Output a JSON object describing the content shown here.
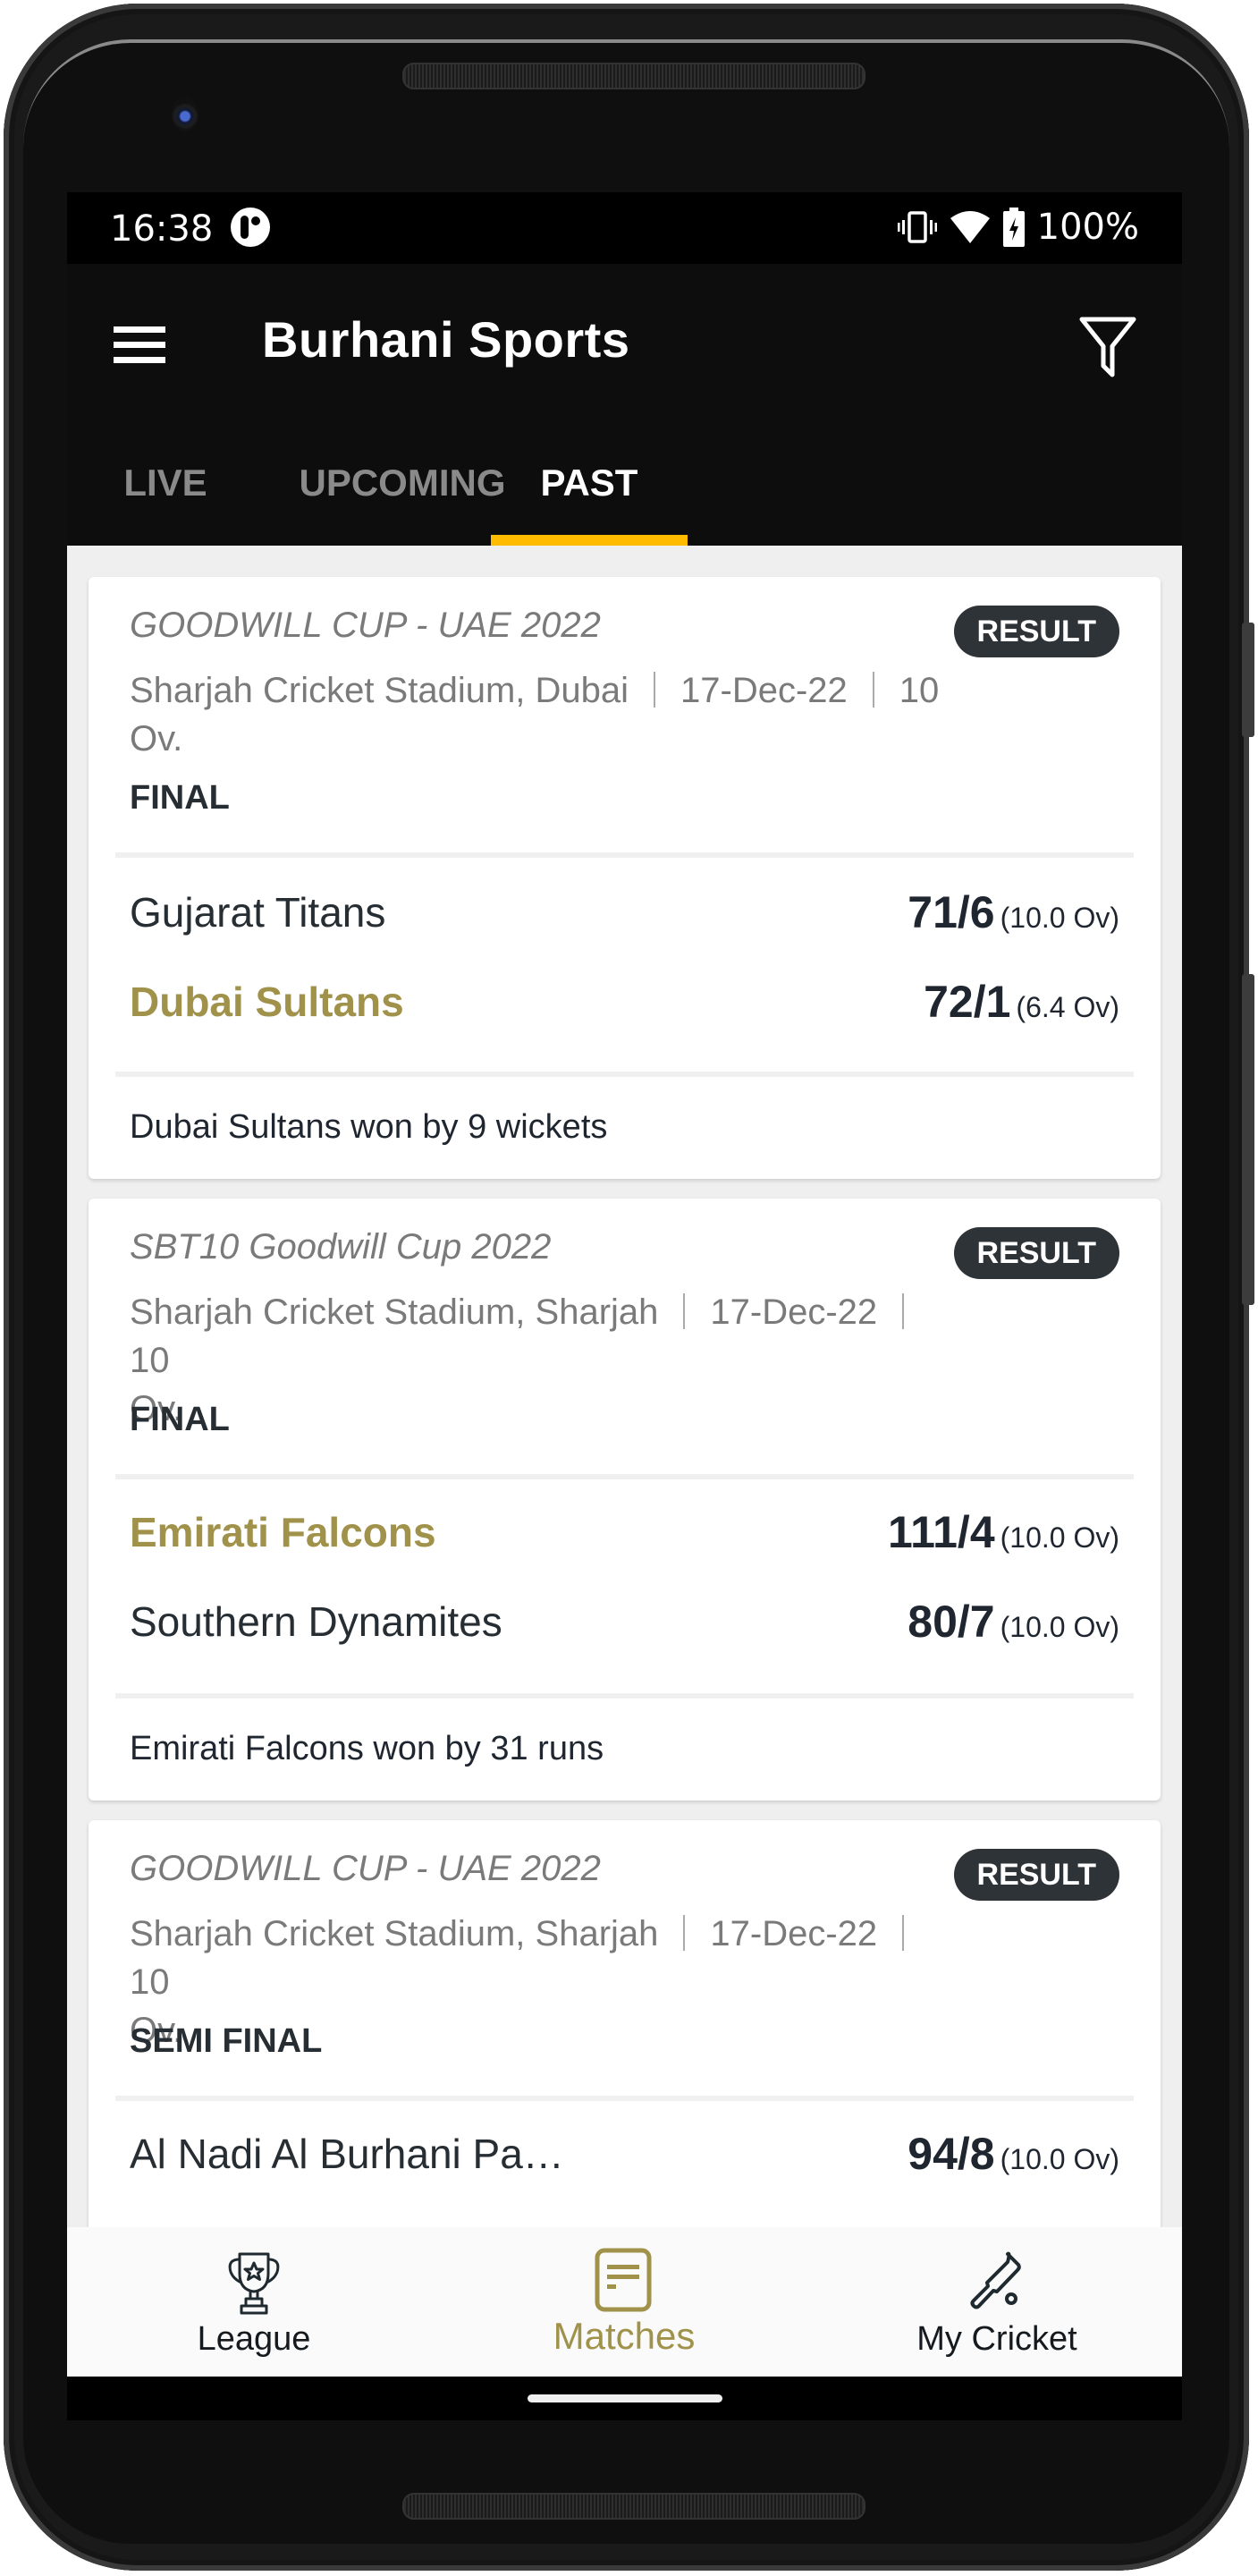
{
  "status_bar": {
    "time": "16:38",
    "battery_percent": "100%",
    "icons": [
      "notification-app-icon",
      "vibrate-icon",
      "wifi-icon",
      "battery-charging-icon"
    ]
  },
  "app_bar": {
    "title": "Burhani Sports",
    "menu_icon": "hamburger-menu-icon",
    "filter_icon": "filter-icon"
  },
  "tabs": [
    {
      "label": "LIVE",
      "active": false
    },
    {
      "label": "UPCOMING",
      "active": false
    },
    {
      "label": "PAST",
      "active": true
    }
  ],
  "colors": {
    "accent_tab_indicator": "#FFBB00",
    "winner_gold": "#A0924A",
    "badge_bg": "#2E3338",
    "app_bar_bg": "#0D0D0D",
    "content_bg": "#EFEFEF"
  },
  "matches": [
    {
      "series": "GOODWILL CUP - UAE 2022",
      "badge": "RESULT",
      "venue": "Sharjah Cricket Stadium, Dubai",
      "date": "17-Dec-22",
      "overs_format_1": "10",
      "overs_format_2": "Ov.",
      "stage": "FINAL",
      "teams": [
        {
          "name": "Gujarat Titans",
          "score": "71/6",
          "overs": "(10.0 Ov)",
          "winner": false
        },
        {
          "name": "Dubai Sultans",
          "score": "72/1",
          "overs": "(6.4 Ov)",
          "winner": true
        }
      ],
      "result": "Dubai Sultans won by 9 wickets"
    },
    {
      "series": "SBT10 Goodwill Cup 2022",
      "badge": "RESULT",
      "venue": "Sharjah Cricket Stadium, Sharjah",
      "date": "17-Dec-22",
      "overs_format_1": "10",
      "overs_format_2": "Ov.",
      "stage": "FINAL",
      "teams": [
        {
          "name": "Emirati Falcons",
          "score": "111/4",
          "overs": "(10.0 Ov)",
          "winner": true
        },
        {
          "name": "Southern Dynamites",
          "score": "80/7",
          "overs": "(10.0 Ov)",
          "winner": false
        }
      ],
      "result": "Emirati Falcons won by 31 runs"
    },
    {
      "series": "GOODWILL CUP - UAE 2022",
      "badge": "RESULT",
      "venue": "Sharjah Cricket Stadium, Sharjah",
      "date": "17-Dec-22",
      "overs_format_1": "10",
      "overs_format_2": "Ov.",
      "stage": "SEMI FINAL",
      "teams": [
        {
          "name": "Al Nadi Al Burhani Pa…",
          "score": "94/8",
          "overs": "(10.0 Ov)",
          "winner": false
        }
      ],
      "result": ""
    }
  ],
  "bottom_nav": [
    {
      "label": "League",
      "icon": "trophy-icon",
      "active": false
    },
    {
      "label": "Matches",
      "icon": "matches-list-icon",
      "active": true
    },
    {
      "label": "My Cricket",
      "icon": "cricket-bat-icon",
      "active": false
    }
  ]
}
